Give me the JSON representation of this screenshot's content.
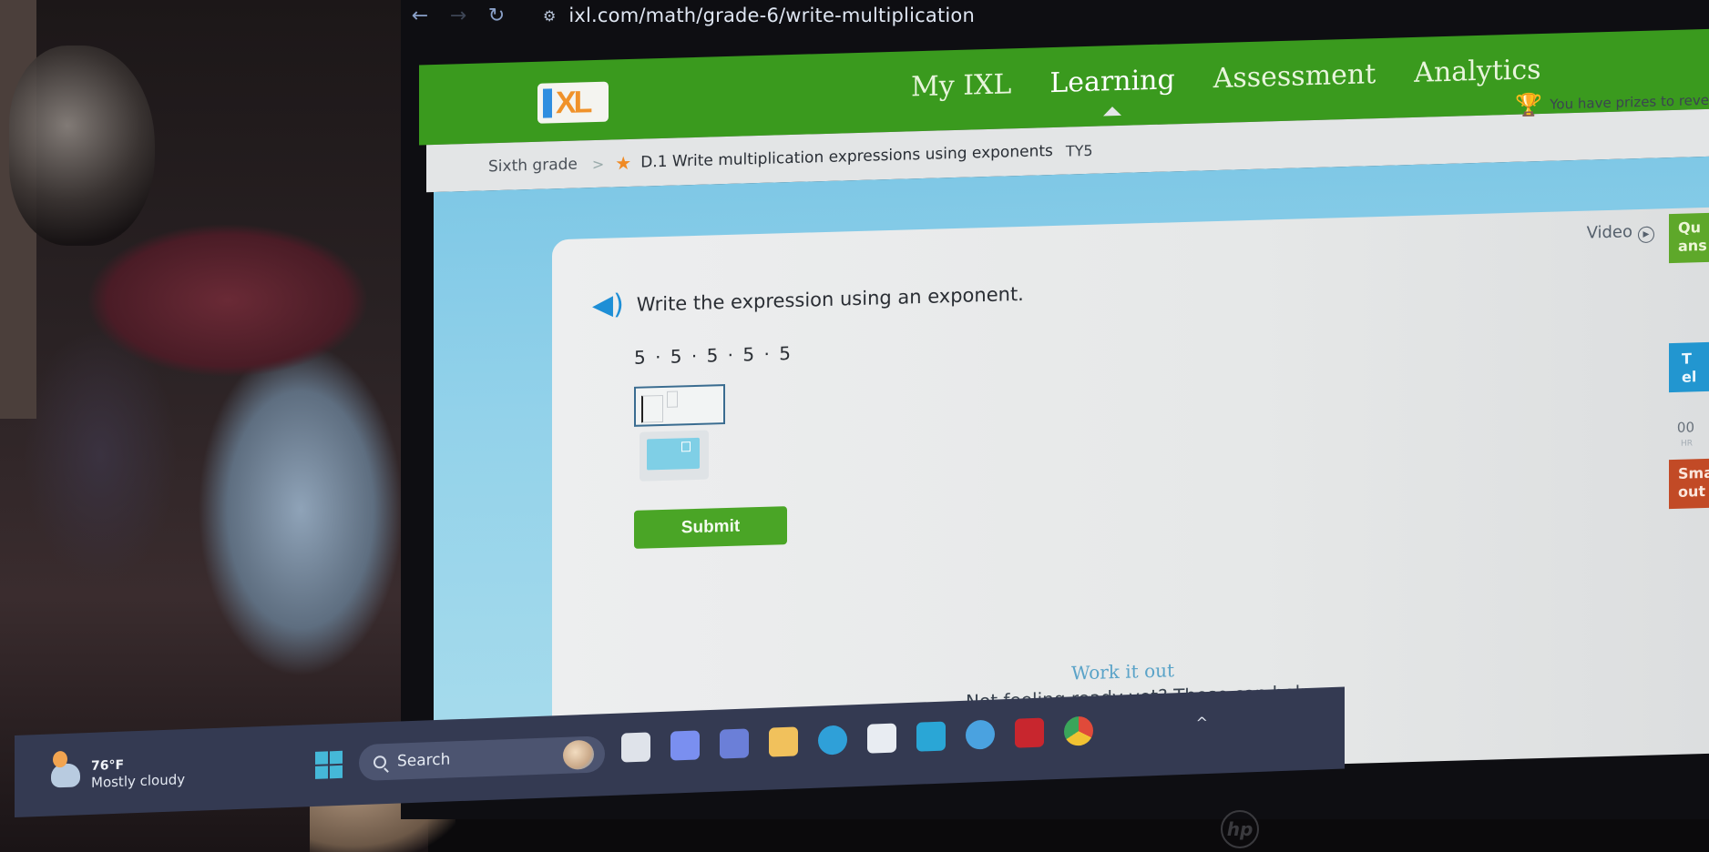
{
  "browser": {
    "back_icon": "arrow-left-icon",
    "forward_icon": "arrow-right-icon",
    "reload_icon": "reload-icon",
    "site_info_icon": "tune-icon",
    "url": "ixl.com/math/grade-6/write-multiplication"
  },
  "header": {
    "logo": "IXL",
    "nav": [
      {
        "label": "My IXL",
        "active": false
      },
      {
        "label": "Learning",
        "active": true
      },
      {
        "label": "Assessment",
        "active": false
      },
      {
        "label": "Analytics",
        "active": false
      }
    ],
    "prizes_text": "You have prizes to reve",
    "prizes_icon": "trophy-icon"
  },
  "breadcrumb": {
    "grade": "Sixth grade",
    "separator": ">",
    "skill": "D.1 Write multiplication expressions using exponents",
    "skill_code": "TY5",
    "star_icon": "star-icon"
  },
  "question": {
    "speaker_icon": "speaker-icon",
    "prompt": "Write the expression using an exponent.",
    "expression": "5 · 5 · 5 · 5 · 5",
    "answer_base": "",
    "answer_exponent": "",
    "keypad_icon": "exponent-keypad-icon",
    "submit_label": "Submit"
  },
  "sidebar": {
    "video_label": "Video",
    "video_icon": "play-circle-icon",
    "questions_answered_label": "Qu\nans",
    "time_elapsed_label": "T\nel",
    "timer_value": "00",
    "timer_unit": "HR",
    "smartscore_label": "Sma\nout"
  },
  "help": {
    "work_it_out": "Work it out",
    "not_ready": "Not feeling ready yet? These can help:"
  },
  "taskbar": {
    "weather_temp": "76°F",
    "weather_condition": "Mostly cloudy",
    "search_placeholder": "Search",
    "apps": [
      {
        "name": "task-view-icon",
        "color": "#dfe3ea"
      },
      {
        "name": "copilot-icon",
        "color": "#7a8ff0"
      },
      {
        "name": "teams-icon",
        "color": "#6b7fd8"
      },
      {
        "name": "file-explorer-icon",
        "color": "#f1c15c"
      },
      {
        "name": "edge-icon",
        "color": "#2fa0d8"
      },
      {
        "name": "microsoft-store-icon",
        "color": "#e8ecf2"
      },
      {
        "name": "help-app-icon",
        "color": "#2aa6d6"
      },
      {
        "name": "get-help-icon",
        "color": "#4aa2e0"
      },
      {
        "name": "mcafee-icon",
        "color": "#c8262e"
      },
      {
        "name": "chrome-icon",
        "color": "#e5a21c"
      }
    ],
    "tray_chevron": "^"
  },
  "device": {
    "brand": "hp"
  }
}
